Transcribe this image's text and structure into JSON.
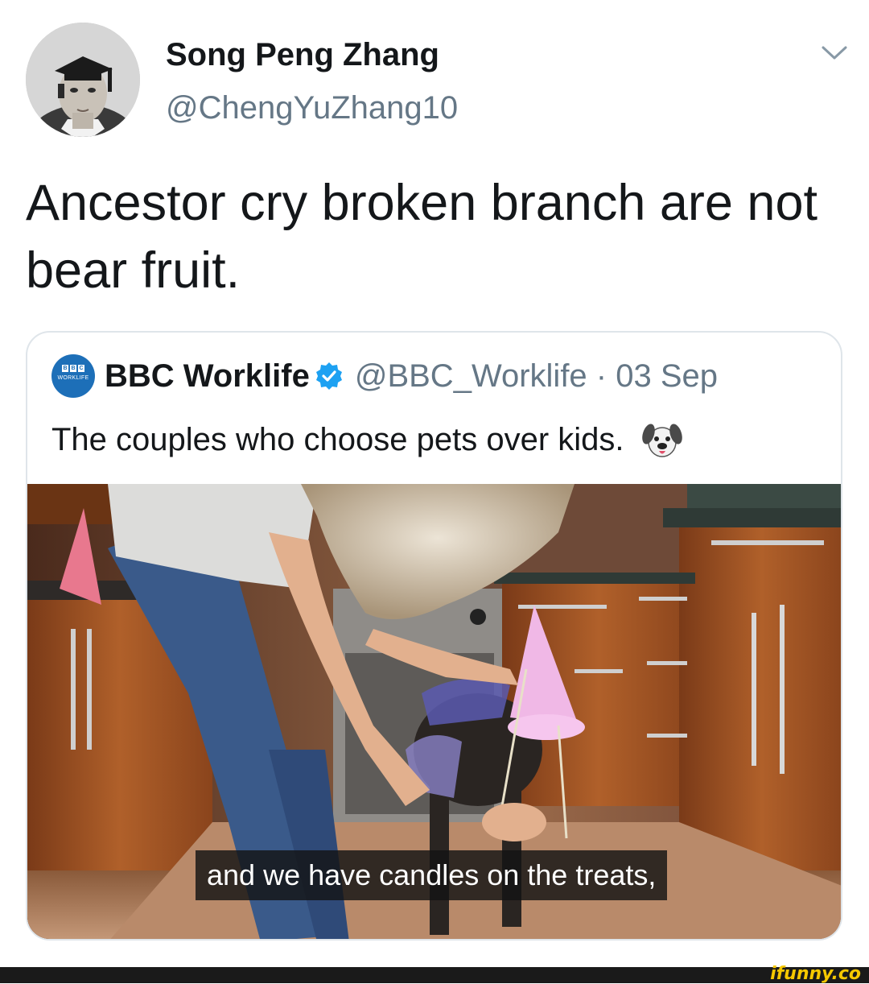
{
  "tweet": {
    "author": {
      "display_name": "Song Peng Zhang",
      "handle": "@ChengYuZhang10",
      "avatar_icon": "portrait-avatar"
    },
    "menu_icon": "chevron-down-icon",
    "text": "Ancestor cry broken branch are not bear fruit."
  },
  "quoted_tweet": {
    "avatar_icon": "bbc-worklife-logo",
    "avatar_logo_letters": [
      "B",
      "B",
      "C"
    ],
    "avatar_logo_sub": "WORKLIFE",
    "account_name": "BBC Worklife",
    "verified_icon": "verified-badge-icon",
    "handle_and_date": "@BBC_Worklife · 03 Sep",
    "text": "The couples who choose pets over kids.",
    "emoji_icon": "dog-face-icon",
    "media": {
      "description_icon": "video-still",
      "caption": "and we have candles on the treats,"
    }
  },
  "footer": {
    "watermark": "ifunny.co"
  },
  "colors": {
    "text_primary": "#14171a",
    "text_secondary": "#657786",
    "verified_blue": "#1da1f2",
    "card_border": "#dfe5ea",
    "watermark_yellow": "#f6c800"
  }
}
